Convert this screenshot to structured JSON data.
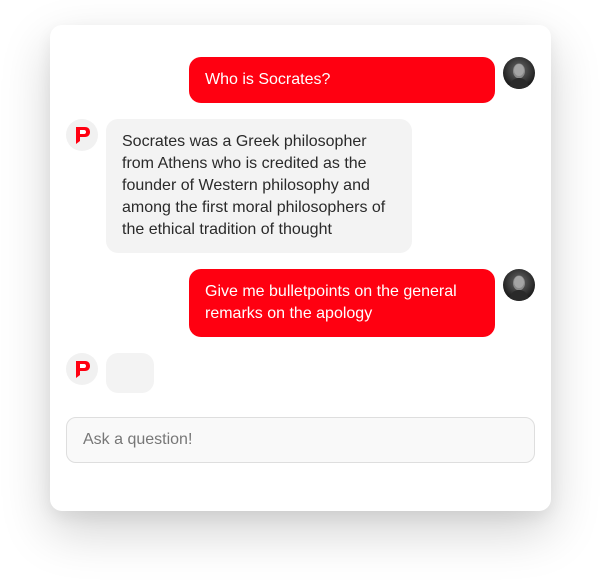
{
  "messages": [
    {
      "role": "user",
      "text": "Who is Socrates?"
    },
    {
      "role": "assistant",
      "text": "Socrates was a Greek philosopher from Athens who is credited as the founder of Western philosophy and among the first moral philosophers of the ethical tradition of thought"
    },
    {
      "role": "user",
      "text": "Give me bulletpoints on the general remarks on the apology"
    },
    {
      "role": "assistant",
      "text": ""
    }
  ],
  "input": {
    "placeholder": "Ask a question!",
    "value": ""
  },
  "colors": {
    "accent": "#ff0011",
    "bot_bubble": "#f3f3f3"
  },
  "icons": {
    "assistant_avatar": "red-flag-logo-icon",
    "user_avatar": "user-photo-avatar"
  }
}
